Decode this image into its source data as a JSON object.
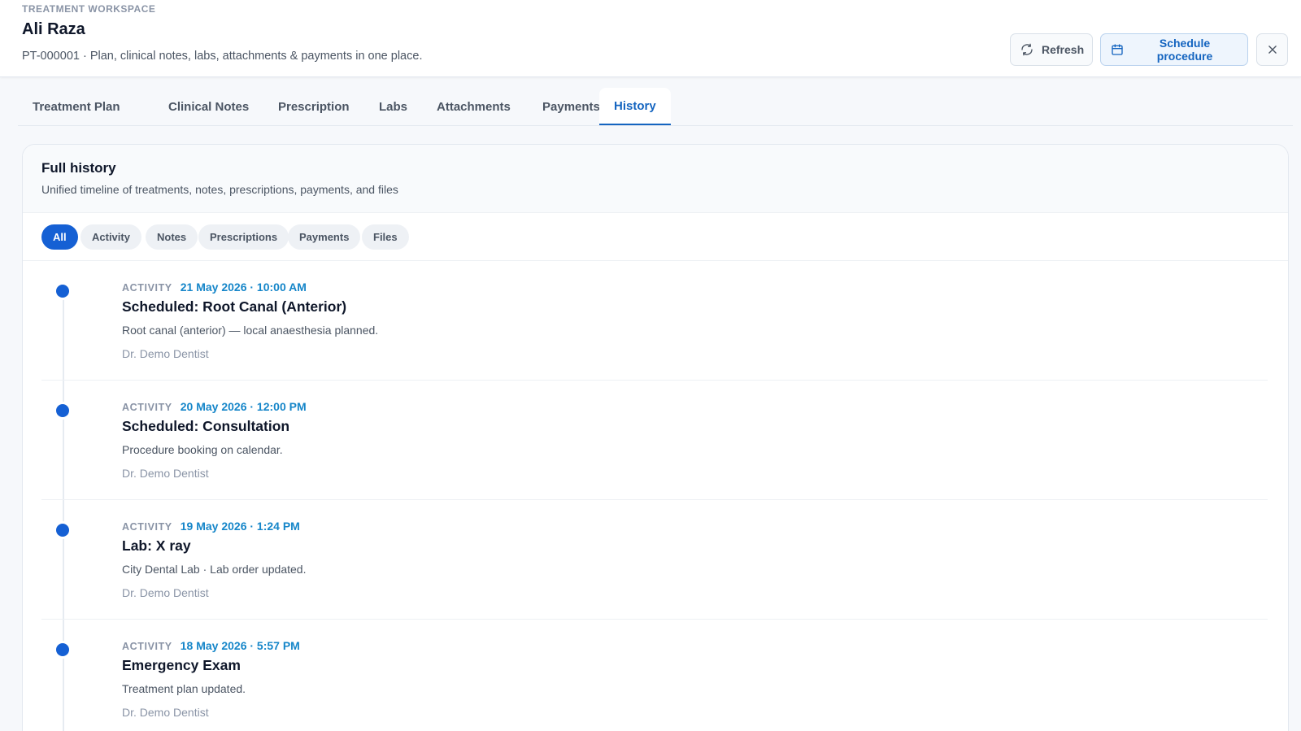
{
  "header": {
    "eyebrow": "TREATMENT WORKSPACE",
    "patient_name": "Ali Raza",
    "subtitle": "PT-000001 · Plan, clinical notes, labs, attachments & payments in one place.",
    "refresh_label": "Refresh",
    "schedule_label": "Schedule procedure"
  },
  "tabs": [
    {
      "label": "Treatment Plan"
    },
    {
      "label": "Clinical Notes"
    },
    {
      "label": "Prescription"
    },
    {
      "label": "Labs"
    },
    {
      "label": "Attachments"
    },
    {
      "label": "Payments"
    },
    {
      "label": "History",
      "active": true
    }
  ],
  "history": {
    "title": "Full history",
    "subtitle": "Unified timeline of treatments, notes, prescriptions, payments, and files",
    "filters": [
      {
        "label": "All",
        "active": true
      },
      {
        "label": "Activity"
      },
      {
        "label": "Notes"
      },
      {
        "label": "Prescriptions"
      },
      {
        "label": "Payments"
      },
      {
        "label": "Files"
      }
    ],
    "entries": [
      {
        "kind": "ACTIVITY",
        "time": "21 May 2026 · 10:00 AM",
        "title": "Scheduled: Root Canal (Anterior)",
        "description": "Root canal (anterior) — local anaesthesia planned.",
        "author": "Dr. Demo Dentist"
      },
      {
        "kind": "ACTIVITY",
        "time": "20 May 2026 · 12:00 PM",
        "title": "Scheduled: Consultation",
        "description": "Procedure booking on calendar.",
        "author": "Dr. Demo Dentist"
      },
      {
        "kind": "ACTIVITY",
        "time": "19 May 2026 · 1:24 PM",
        "title": "Lab: X ray",
        "description": "City Dental Lab · Lab order updated.",
        "author": "Dr. Demo Dentist"
      },
      {
        "kind": "ACTIVITY",
        "time": "18 May 2026 · 5:57 PM",
        "title": "Emergency Exam",
        "description": "Treatment plan updated.",
        "author": "Dr. Demo Dentist"
      }
    ]
  },
  "colors": {
    "accent": "#1560d4",
    "link": "#1565c0",
    "timestamp": "#1686c9"
  },
  "icons": {
    "refresh": "refresh-icon",
    "schedule": "calendar-icon",
    "close": "close-icon"
  }
}
